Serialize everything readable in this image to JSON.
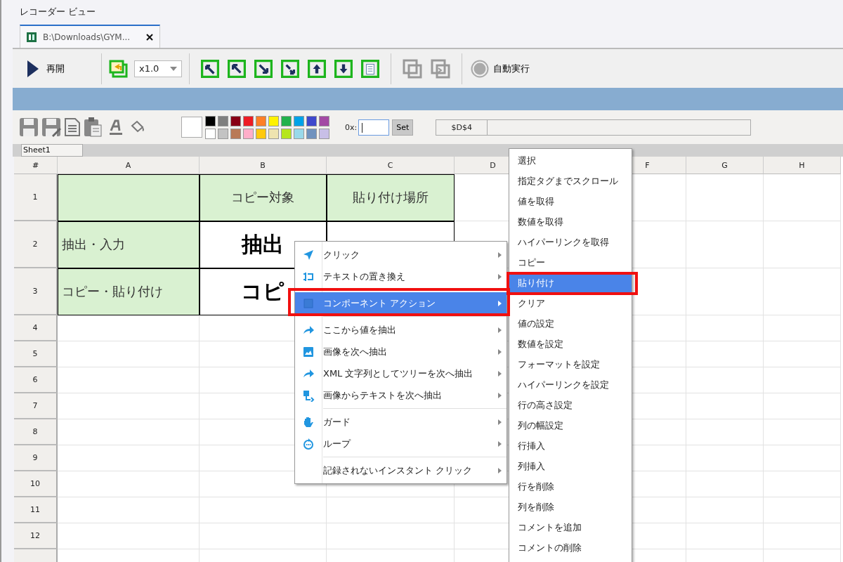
{
  "window": {
    "title": "レコーダー ビュー"
  },
  "tabs": [
    {
      "label": "B:\\Downloads\\GYM...",
      "selected": true
    }
  ],
  "toolbar": {
    "resume_button": "再開",
    "speed": "x1.0",
    "auto_run": "自動実行"
  },
  "format_bar": {
    "palette": [
      {
        "color": "#000000"
      },
      {
        "color": "#7f7f7f"
      },
      {
        "color": "#880015"
      },
      {
        "color": "#ed1c24"
      },
      {
        "color": "#ff7f27"
      },
      {
        "color": "#fff200"
      },
      {
        "color": "#22b14c"
      },
      {
        "color": "#00a2e8"
      },
      {
        "color": "#3f48cc"
      },
      {
        "color": "#a349a4"
      },
      {
        "color": "#ffffff"
      },
      {
        "color": "#c3c3c3"
      },
      {
        "color": "#b97a57"
      },
      {
        "color": "#ffaec9"
      },
      {
        "color": "#ffc90e"
      },
      {
        "color": "#efe4b0"
      },
      {
        "color": "#b5e61d"
      },
      {
        "color": "#99d9ea"
      },
      {
        "color": "#7092be"
      },
      {
        "color": "#c8bfe7"
      }
    ],
    "code_label": "0x:",
    "set_button": "Set",
    "cell_ref": "$D$4"
  },
  "sheet_tabs": [
    {
      "label": "Sheet1",
      "selected": true
    }
  ],
  "grid": {
    "corner": "#",
    "columns": [
      {
        "label": "A"
      },
      {
        "label": "B"
      },
      {
        "label": "C"
      },
      {
        "label": "D"
      },
      {},
      {
        "label": "F"
      },
      {
        "label": "G"
      },
      {
        "label": "H"
      }
    ],
    "rows": [
      {
        "label": "1",
        "cells": [
          {
            "shaded": true,
            "bold": false
          },
          {
            "text": "コピー対象",
            "shaded": true,
            "bold": false
          },
          {
            "text": "貼り付け場所",
            "shaded": true,
            "bold": false
          }
        ]
      },
      {
        "label": "2",
        "cells": [
          {
            "text": "抽出・入力",
            "shaded": true,
            "bold": false
          },
          {
            "text": "抽出",
            "shaded": false,
            "bold": true
          },
          {
            "shaded": false,
            "bold": false
          }
        ]
      },
      {
        "label": "3",
        "cells": [
          {
            "text": "コピー・貼り付け",
            "shaded": true,
            "bold": false
          },
          {
            "text": "コピ",
            "shaded": false,
            "bold": true
          }
        ]
      },
      {
        "label": "4"
      },
      {
        "label": "5"
      },
      {
        "label": "6"
      },
      {
        "label": "7"
      },
      {
        "label": "8"
      },
      {
        "label": "9"
      },
      {
        "label": "10"
      },
      {
        "label": "11"
      },
      {
        "label": "12"
      }
    ]
  },
  "context_menu": {
    "groups": [
      [
        {
          "label": "クリック",
          "selected": false
        },
        {
          "label": "テキストの置き換え",
          "selected": false
        }
      ],
      [
        {
          "label": "コンポーネント アクション",
          "selected": true
        }
      ],
      [
        {
          "label": "ここから値を抽出",
          "selected": false
        },
        {
          "label": "画像を次へ抽出",
          "selected": false
        },
        {
          "label": "XML 文字列としてツリーを次へ抽出",
          "selected": false
        },
        {
          "label": "画像からテキストを次へ抽出",
          "selected": false
        }
      ],
      [
        {
          "label": "ガード",
          "selected": false
        },
        {
          "label": "ループ",
          "selected": false
        }
      ],
      [
        {
          "label": "記録されないインスタント クリック",
          "selected": false
        }
      ]
    ]
  },
  "submenu": {
    "items": [
      {
        "label": "選択",
        "selected": false
      },
      {
        "label": "指定タグまでスクロール",
        "selected": false
      },
      {
        "label": "値を取得",
        "selected": false
      },
      {
        "label": "数値を取得",
        "selected": false
      },
      {
        "label": "ハイパーリンクを取得",
        "selected": false
      },
      {
        "label": "コピー",
        "selected": false
      },
      {
        "label": "貼り付け",
        "selected": true
      },
      {
        "label": "クリア",
        "selected": false
      },
      {
        "label": "値の設定",
        "selected": false
      },
      {
        "label": "数値を設定",
        "selected": false
      },
      {
        "label": "フォーマットを設定",
        "selected": false
      },
      {
        "label": "ハイパーリンクを設定",
        "selected": false
      },
      {
        "label": "行の高さ設定",
        "selected": false
      },
      {
        "label": "列の幅設定",
        "selected": false
      },
      {
        "label": "行挿入",
        "selected": false
      },
      {
        "label": "列挿入",
        "selected": false
      },
      {
        "label": "行を削除",
        "selected": false
      },
      {
        "label": "列を削除",
        "selected": false
      },
      {
        "label": "コメントを追加",
        "selected": false
      },
      {
        "label": "コメントの削除",
        "selected": false
      }
    ]
  }
}
